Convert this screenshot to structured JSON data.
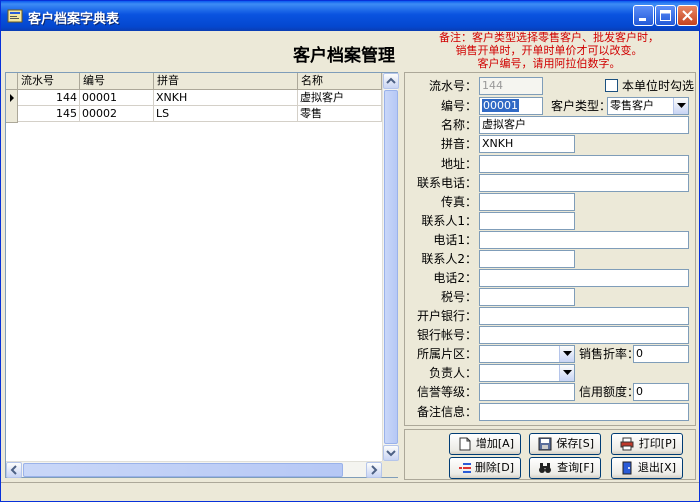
{
  "window": {
    "title": "客户档案字典表"
  },
  "header": {
    "title": "客户档案管理",
    "note": [
      "备注：客户类型选择零售客户、批发客户时，",
      "销售开单时，开单时单价才可以改变。",
      "客户编号，请用阿拉伯数字。"
    ]
  },
  "grid": {
    "columns": [
      "流水号",
      "编号",
      "拼音",
      "名称"
    ],
    "rows": [
      {
        "serial": "144",
        "code": "00001",
        "pinyin": "XNKH",
        "name": "虚拟客户"
      },
      {
        "serial": "145",
        "code": "00002",
        "pinyin": "LS",
        "name": "零售"
      }
    ]
  },
  "form": {
    "serial_label": "流水号：",
    "serial_value": "144",
    "unit_check_label": "本单位时勾选",
    "code_label": "编号：",
    "code_value": "00001",
    "type_label": "客户类型：",
    "type_value": "零售客户",
    "name_label": "名称：",
    "name_value": "虚拟客户",
    "pinyin_label": "拼音：",
    "pinyin_value": "XNKH",
    "address_label": "地址：",
    "phone_label": "联系电话：",
    "fax_label": "传真：",
    "contact1_label": "联系人1：",
    "tel1_label": "电话1：",
    "contact2_label": "联系人2：",
    "tel2_label": "电话2：",
    "taxno_label": "税号：",
    "bank_label": "开户银行：",
    "account_label": "银行帐号：",
    "region_label": "所属片区：",
    "discount_label": "销售折率：",
    "discount_value": "0",
    "manager_label": "负责人：",
    "credit_level_label": "信誉等级：",
    "credit_limit_label": "信用额度：",
    "credit_limit_value": "0",
    "remark_label": "备注信息："
  },
  "buttons": {
    "add": "增加[A]",
    "save": "保存[S]",
    "print": "打印[P]",
    "delete": "删除[D]",
    "query": "查询[F]",
    "exit": "退出[X]"
  },
  "colors": {
    "titlebar": "#0a53e0",
    "note": "#d00000",
    "selection": "#316ac5"
  }
}
